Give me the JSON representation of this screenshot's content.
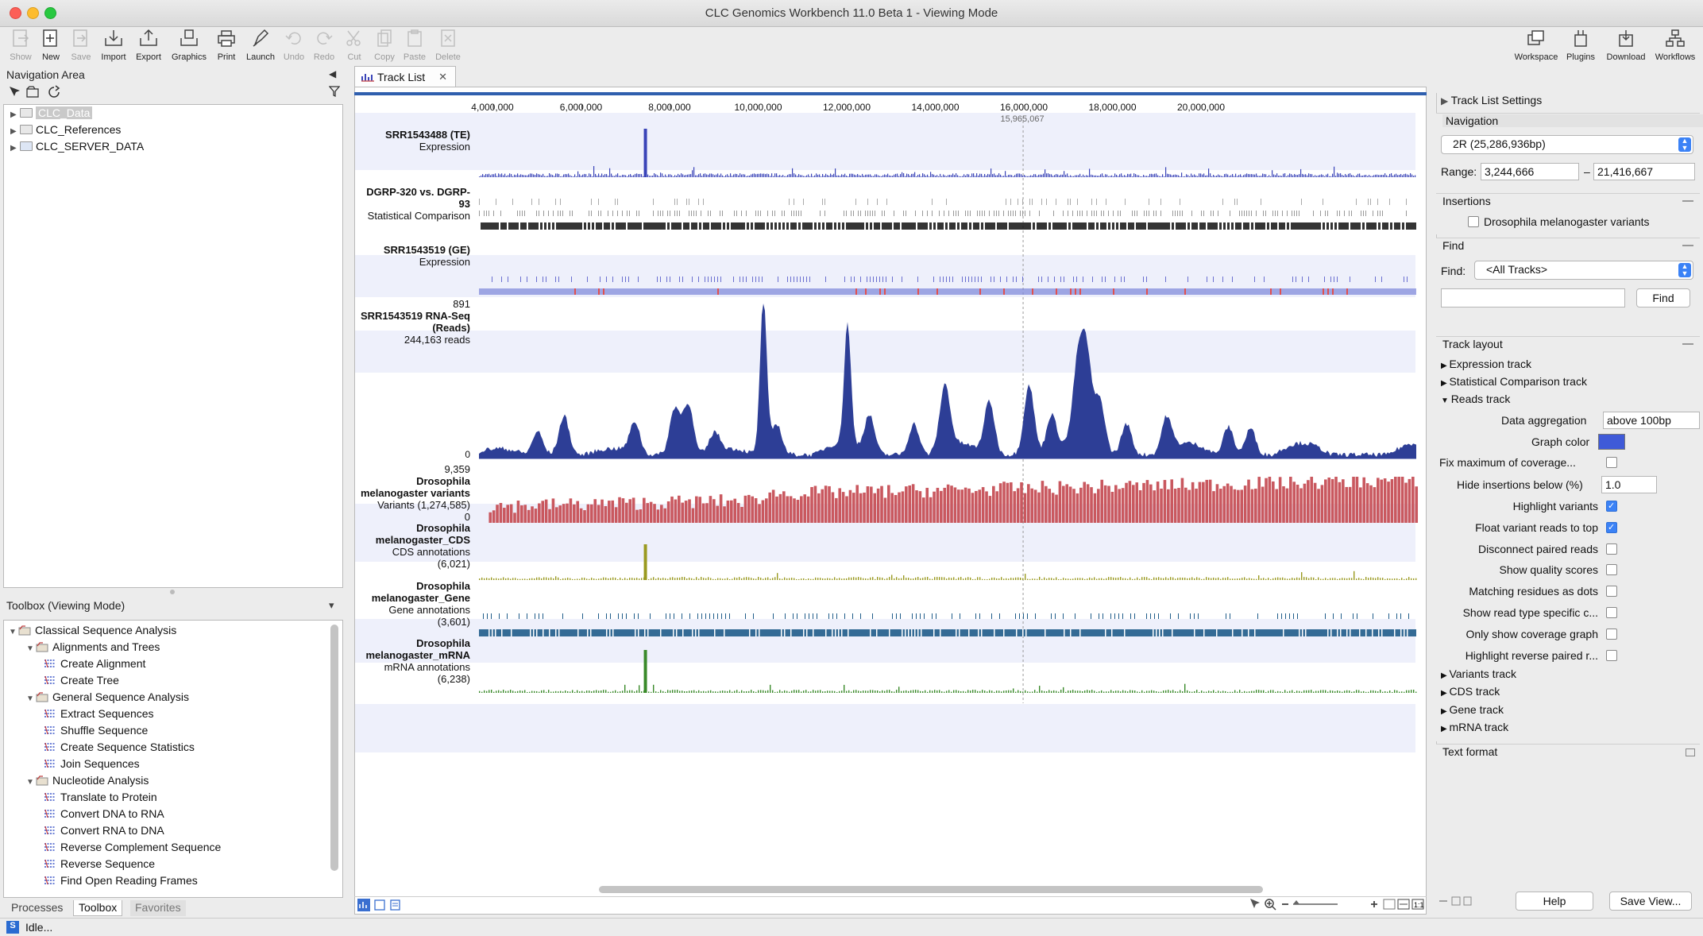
{
  "window": {
    "title": "CLC Genomics Workbench 11.0 Beta 1 - Viewing Mode"
  },
  "toolbar": {
    "left": [
      {
        "label": "Show",
        "icon": "show-icon",
        "enabled": false
      },
      {
        "label": "New",
        "icon": "new-icon",
        "enabled": true
      },
      {
        "label": "Save",
        "icon": "save-icon",
        "enabled": false
      },
      {
        "label": "Import",
        "icon": "import-icon",
        "enabled": true
      },
      {
        "label": "Export",
        "icon": "export-icon",
        "enabled": true
      },
      {
        "label": "Graphics",
        "icon": "graphics-icon",
        "enabled": true
      },
      {
        "label": "Print",
        "icon": "print-icon",
        "enabled": true
      },
      {
        "label": "Launch",
        "icon": "launch-icon",
        "enabled": true
      },
      {
        "label": "Undo",
        "icon": "undo-icon",
        "enabled": false
      },
      {
        "label": "Redo",
        "icon": "redo-icon",
        "enabled": false
      },
      {
        "label": "Cut",
        "icon": "cut-icon",
        "enabled": false
      },
      {
        "label": "Copy",
        "icon": "copy-icon",
        "enabled": false
      },
      {
        "label": "Paste",
        "icon": "paste-icon",
        "enabled": false
      },
      {
        "label": "Delete",
        "icon": "delete-icon",
        "enabled": false
      }
    ],
    "right": [
      {
        "label": "Workspace",
        "icon": "workspace-icon"
      },
      {
        "label": "Plugins",
        "icon": "plugins-icon"
      },
      {
        "label": "Download",
        "icon": "download-icon"
      },
      {
        "label": "Workflows",
        "icon": "workflows-icon"
      }
    ]
  },
  "navigation": {
    "title": "Navigation Area",
    "items": [
      "CLC_Data",
      "CLC_References",
      "CLC_SERVER_DATA"
    ]
  },
  "toolbox": {
    "title": "Toolbox (Viewing Mode)",
    "items": [
      {
        "label": "Classical Sequence Analysis",
        "level": 0
      },
      {
        "label": "Alignments and Trees",
        "level": 1
      },
      {
        "label": "Create Alignment",
        "level": 2
      },
      {
        "label": "Create Tree",
        "level": 2
      },
      {
        "label": "General Sequence Analysis",
        "level": 1
      },
      {
        "label": "Extract Sequences",
        "level": 2
      },
      {
        "label": "Shuffle Sequence",
        "level": 2
      },
      {
        "label": "Create Sequence Statistics",
        "level": 2
      },
      {
        "label": "Join Sequences",
        "level": 2
      },
      {
        "label": "Nucleotide Analysis",
        "level": 1
      },
      {
        "label": "Translate to Protein",
        "level": 2
      },
      {
        "label": "Convert DNA to RNA",
        "level": 2
      },
      {
        "label": "Convert RNA to DNA",
        "level": 2
      },
      {
        "label": "Reverse Complement Sequence",
        "level": 2
      },
      {
        "label": "Reverse Sequence",
        "level": 2
      },
      {
        "label": "Find Open Reading Frames",
        "level": 2
      }
    ],
    "tabs": [
      "Processes",
      "Toolbox",
      "Favorites"
    ]
  },
  "status": {
    "text": "Idle..."
  },
  "editor": {
    "tab_label": "Track List",
    "axis_ticks": [
      "4,000,000",
      "6,000,000",
      "8,000,000",
      "10,000,000",
      "12,000,000",
      "14,000,000",
      "16,000,000",
      "18,000,000",
      "20,000,000"
    ],
    "cursor_position": "15,965,067",
    "tracks": {
      "te": {
        "name": "SRR1543488 (TE)",
        "type": "Expression"
      },
      "stat": {
        "name1": "DGRP-320 vs. DGRP-",
        "name2": "93",
        "type": "Statistical Comparison"
      },
      "ge": {
        "name": "SRR1543519 (GE)",
        "type": "Expression"
      },
      "reads": {
        "max": "891",
        "name1": "SRR1543519 RNA-Seq",
        "name2": "(Reads)",
        "count": "244,163 reads",
        "min": "0"
      },
      "variants": {
        "max": "9,359",
        "name1": "Drosophila",
        "name2": "melanogaster variants",
        "count": "Variants (1,274,585)",
        "min": "0"
      },
      "cds": {
        "name1": "Drosophila",
        "name2": "melanogaster_CDS",
        "type": "CDS annotations",
        "count": "(6,021)"
      },
      "gene": {
        "name1": "Drosophila",
        "name2": "melanogaster_Gene",
        "type": "Gene annotations",
        "count": "(3,601)"
      },
      "mrna": {
        "name1": "Drosophila",
        "name2": "melanogaster_mRNA",
        "type": "mRNA annotations",
        "count": "(6,238)"
      }
    },
    "colors": {
      "reads": "#2d3e96",
      "variants": "#c9585f",
      "cds": "#9a9a20",
      "gene": "#1f5c8a",
      "mrna": "#3a8a2a",
      "expression": "#3a44b8"
    }
  },
  "settings": {
    "title": "Track List Settings",
    "navigation": {
      "header": "Navigation",
      "chromosome": "2R (25,286,936bp)",
      "range_label": "Range:",
      "range_from": "3,244,666",
      "range_sep": "–",
      "range_to": "21,416,667"
    },
    "insertions": {
      "header": "Insertions",
      "option": "Drosophila melanogaster variants"
    },
    "find": {
      "header": "Find",
      "label": "Find:",
      "scope": "<All Tracks>",
      "query": "",
      "button": "Find"
    },
    "layout": {
      "header": "Track layout",
      "collapsed_top": [
        "Expression track",
        "Statistical Comparison track"
      ],
      "expanded": "Reads track",
      "data_aggregation_label": "Data aggregation",
      "data_aggregation_value": "above 100bp",
      "graph_color_label": "Graph color",
      "graph_color": "#3f5ad8",
      "fix_max_label": "Fix maximum of coverage...",
      "hide_insertions_label": "Hide insertions below (%)",
      "hide_insertions_value": "1.0",
      "options": [
        {
          "label": "Highlight variants",
          "checked": true
        },
        {
          "label": "Float variant reads to top",
          "checked": true
        },
        {
          "label": "Disconnect paired reads",
          "checked": false
        },
        {
          "label": "Show quality scores",
          "checked": false
        },
        {
          "label": "Matching residues as dots",
          "checked": false
        },
        {
          "label": "Show read type specific c...",
          "checked": false
        },
        {
          "label": "Only show coverage graph",
          "checked": false
        },
        {
          "label": "Highlight reverse paired r...",
          "checked": false
        }
      ],
      "collapsed_bottom": [
        "Variants track",
        "CDS track",
        "Gene track",
        "mRNA track"
      ]
    },
    "text_format": {
      "header": "Text format"
    },
    "buttons": {
      "help": "Help",
      "save_view": "Save View..."
    }
  }
}
